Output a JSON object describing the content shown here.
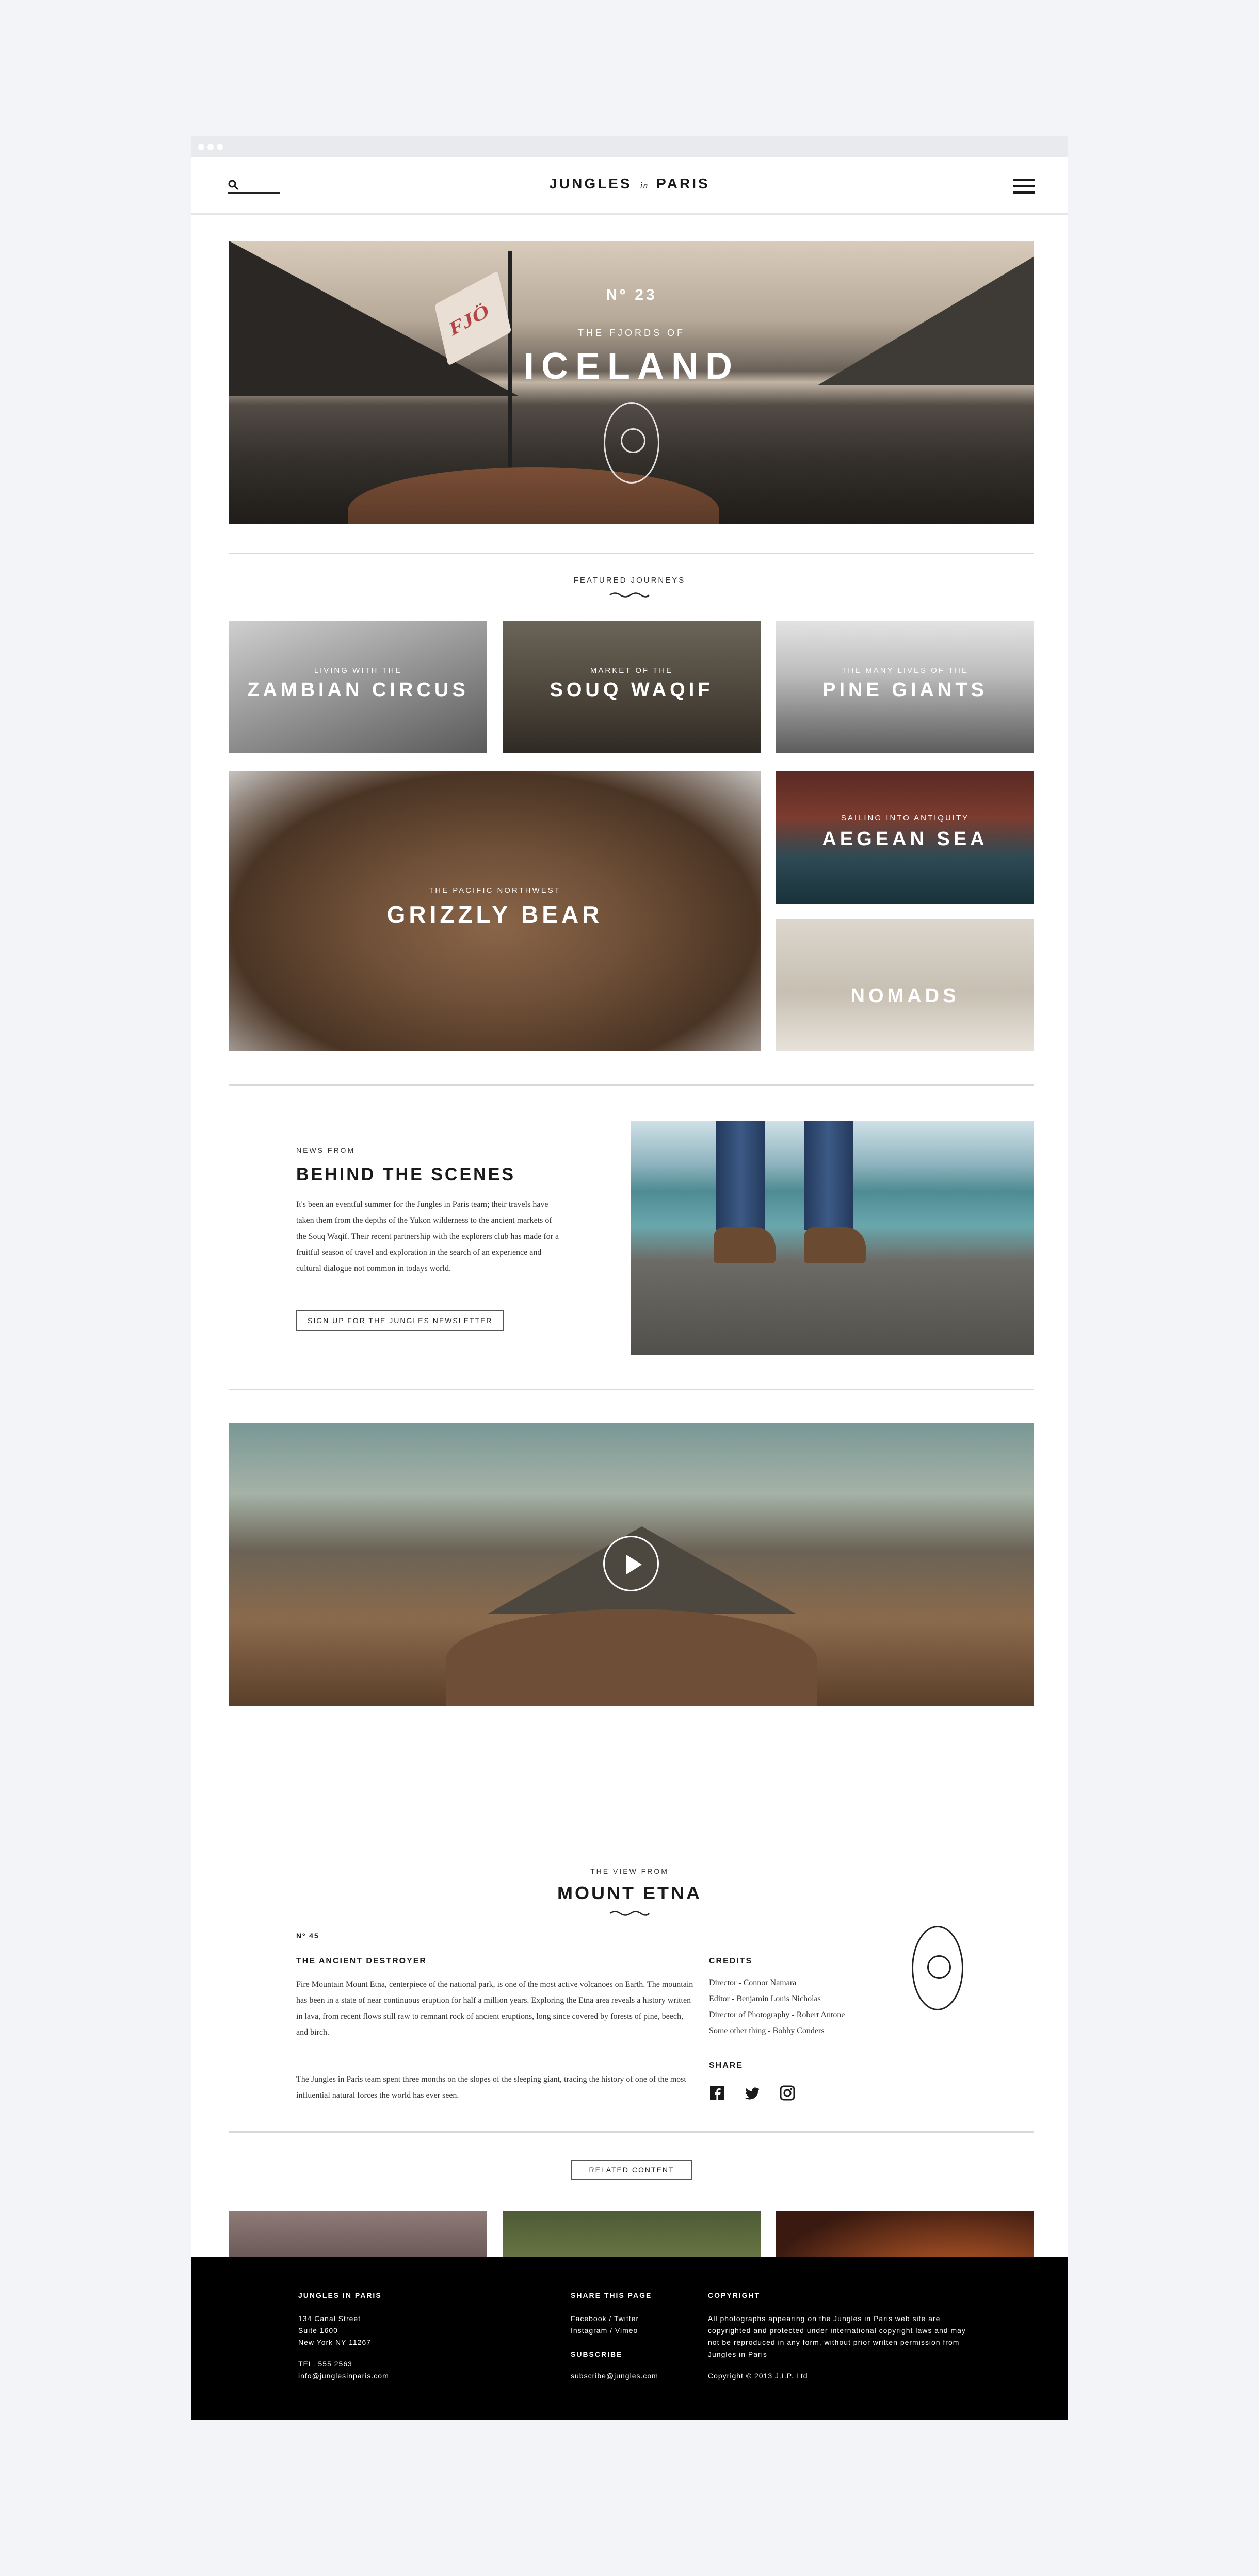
{
  "header": {
    "logo_left": "JUNGLES",
    "logo_mid": "in",
    "logo_right": "PARIS",
    "search_placeholder": ""
  },
  "hero": {
    "issue": "Nº 23",
    "kicker": "THE FJORDS OF",
    "title": "ICELAND",
    "flag_text": "FJÖ"
  },
  "featured": {
    "label": "FEATURED JOURNEYS",
    "cards": [
      {
        "small": "LIVING WITH THE",
        "big": "ZAMBIAN CIRCUS"
      },
      {
        "small": "MARKET OF THE",
        "big": "SOUQ WAQIF"
      },
      {
        "small": "THE MANY LIVES OF THE",
        "big": "PINE GIANTS"
      },
      {
        "small": "THE PACIFIC NORTHWEST",
        "big": "GRIZZLY BEAR"
      },
      {
        "small": "SAILING INTO ANTIQUITY",
        "big": "AEGEAN SEA"
      },
      {
        "small": "",
        "big": "NOMADS"
      }
    ]
  },
  "behind": {
    "kicker": "NEWS FROM",
    "title": "BEHIND THE SCENES",
    "body": "It's been an eventful summer for the Jungles in Paris team; their travels have taken them from the depths of the Yukon wilderness to the ancient markets of the Souq Waqif. Their recent partnership with the explorers club has made for a fruitful season of travel and exploration in the search of an experience and cultural dialogue not common in todays world.",
    "button": "SIGN UP FOR THE JUNGLES NEWSLETTER"
  },
  "etna": {
    "kicker": "THE VIEW FROM",
    "title": "MOUNT ETNA",
    "issue": "Nº 45",
    "subtitle": "THE ANCIENT DESTROYER",
    "body1": "Fire Mountain Mount Etna, centerpiece of the national park, is one of the most active volcanoes on Earth. The mountain has been in a state of near continuous eruption for half a million years. Exploring the Etna area reveals a history written in lava, from recent flows still raw to remnant rock of ancient eruptions, long since covered by forests of pine, beech, and birch.",
    "body2": "The Jungles in Paris team spent three months on the slopes of the sleeping giant, tracing the history of one of the most influential natural forces the world has ever seen.",
    "credits_heading": "CREDITS",
    "credits": [
      "Director - Connor Namara",
      "Editor - Benjamin Louis Nicholas",
      "Director of Photography - Robert Antone",
      "Some other thing - Bobby Conders"
    ],
    "share_heading": "SHARE"
  },
  "related": {
    "button": "RELATED CONTENT"
  },
  "footer": {
    "col1_heading": "JUNGLES IN PARIS",
    "address": [
      "134 Canal Street",
      "Suite 1600",
      "New York NY 11267"
    ],
    "phone": "TEL. 555 2563",
    "email": "info@junglesinparis.com",
    "share_heading": "SHARE THIS PAGE",
    "share_links": [
      "Facebook / Twitter",
      "Instagram / Vimeo"
    ],
    "subscribe_heading": "SUBSCRIBE",
    "subscribe_email": "subscribe@jungles.com",
    "copyright_heading": "COPYRIGHT",
    "copyright_text": "All photographs appearing on the Jungles in Paris web site are copyrighted and protected under international copyright laws and may not be reproduced in any form, without prior written permission from Jungles in Paris",
    "copyright_line": "Copyright © 2013 J.I.P. Ltd"
  },
  "colors": {
    "page_bg": "#f3f4f7",
    "content_bg": "#ffffff",
    "footer_bg": "#000000",
    "text": "#1a1a1a"
  },
  "icons": [
    "search-icon",
    "menu-icon",
    "play-icon",
    "facebook-icon",
    "twitter-icon",
    "instagram-icon",
    "badge-seal-icon"
  ]
}
